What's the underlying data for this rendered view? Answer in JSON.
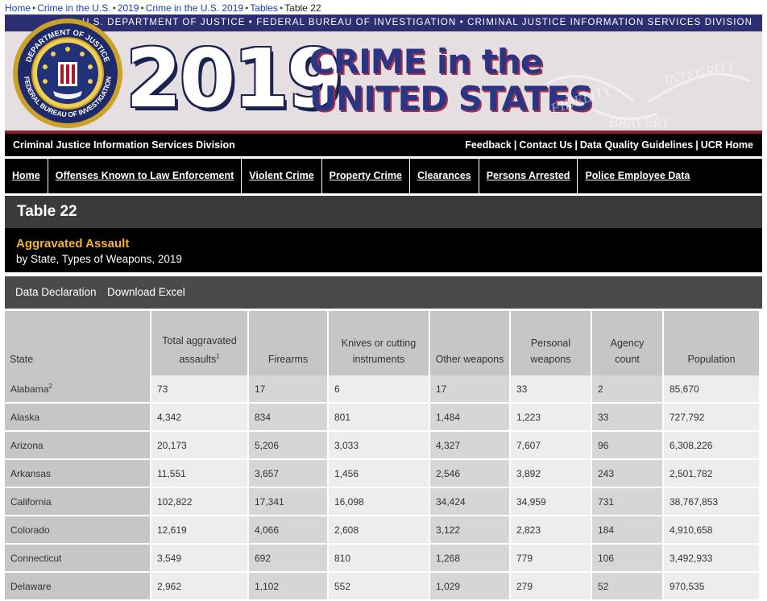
{
  "breadcrumb": {
    "items": [
      "Home",
      "Crime in the U.S.",
      "2019",
      "Crime in the U.S. 2019",
      "Tables"
    ],
    "current": "Table 22",
    "separator": "•"
  },
  "banner": {
    "agencies": "U.S. DEPARTMENT OF JUSTICE • FEDERAL BUREAU OF INVESTIGATION • CRIMINAL JUSTICE INFORMATION SERVICES DIVISION",
    "year": "2019",
    "line1": "CRIME in the",
    "line2": "UNITED STATES",
    "seal_top": "DEPARTMENT OF JUSTICE",
    "seal_bottom": "FEDERAL BUREAU OF INVESTIGATION",
    "motto": [
      "FIDELITY",
      "BRAVERY",
      "INTEGRITY"
    ]
  },
  "cjis_bar": {
    "left": "Criminal Justice Information Services Division",
    "links": [
      "Feedback",
      "Contact Us",
      "Data Quality Guidelines",
      "UCR Home"
    ]
  },
  "nav": [
    "Home",
    "Offenses Known to Law Enforcement",
    "Violent Crime",
    "Property Crime",
    "Clearances",
    "Persons Arrested",
    "Police Employee Data"
  ],
  "table_label": "Table 22",
  "subtitle": {
    "title": "Aggravated Assault",
    "sub": "by State, Types of Weapons, 2019"
  },
  "actions": [
    "Data Declaration",
    "Download Excel"
  ],
  "table": {
    "headers": [
      "State",
      "Total aggravated assaults",
      "Firearms",
      "Knives or cutting instruments",
      "Other weapons",
      "Personal weapons",
      "Agency count",
      "Population"
    ],
    "header_footnote": "1",
    "rows": [
      {
        "state": "Alabama",
        "note": "2",
        "cells": [
          "73",
          "17",
          "6",
          "17",
          "33",
          "2",
          "85,670"
        ]
      },
      {
        "state": "Alaska",
        "note": "",
        "cells": [
          "4,342",
          "834",
          "801",
          "1,484",
          "1,223",
          "33",
          "727,792"
        ]
      },
      {
        "state": "Arizona",
        "note": "",
        "cells": [
          "20,173",
          "5,206",
          "3,033",
          "4,327",
          "7,607",
          "96",
          "6,308,226"
        ]
      },
      {
        "state": "Arkansas",
        "note": "",
        "cells": [
          "11,551",
          "3,657",
          "1,456",
          "2,546",
          "3,892",
          "243",
          "2,501,782"
        ]
      },
      {
        "state": "California",
        "note": "",
        "cells": [
          "102,822",
          "17,341",
          "16,098",
          "34,424",
          "34,959",
          "731",
          "38,767,853"
        ]
      },
      {
        "state": "Colorado",
        "note": "",
        "cells": [
          "12,619",
          "4,066",
          "2,608",
          "3,122",
          "2,823",
          "184",
          "4,910,658"
        ]
      },
      {
        "state": "Connecticut",
        "note": "",
        "cells": [
          "3,549",
          "692",
          "810",
          "1,268",
          "779",
          "106",
          "3,492,933"
        ]
      },
      {
        "state": "Delaware",
        "note": "",
        "cells": [
          "2,962",
          "1,102",
          "552",
          "1,029",
          "279",
          "52",
          "970,535"
        ]
      }
    ]
  },
  "colors": {
    "nav_bg": "#000000",
    "title_bar": "#3b3b3b",
    "accent": "#f5b133",
    "banner_navy": "#2c2f72",
    "banner_red": "#8b1d2c"
  }
}
